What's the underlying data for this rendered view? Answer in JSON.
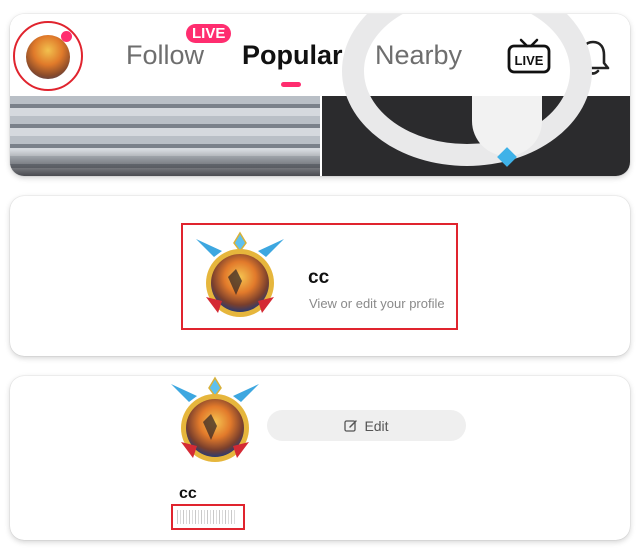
{
  "nav": {
    "tabs": [
      "Follow",
      "Popular",
      "Nearby"
    ],
    "active_tab": "Popular",
    "live_badge": "LIVE",
    "live_icon_text": "LIVE",
    "accent_color": "#ff2d6f",
    "icons": [
      "avatar",
      "live-tv-icon",
      "bell-icon"
    ]
  },
  "profile_card": {
    "name": "cc",
    "subtitle": "View or edit your profile"
  },
  "profile_detail": {
    "edit_label": "Edit",
    "name": "cc",
    "icons": [
      "pencil-icon"
    ]
  },
  "highlight_color": "#e0242e"
}
